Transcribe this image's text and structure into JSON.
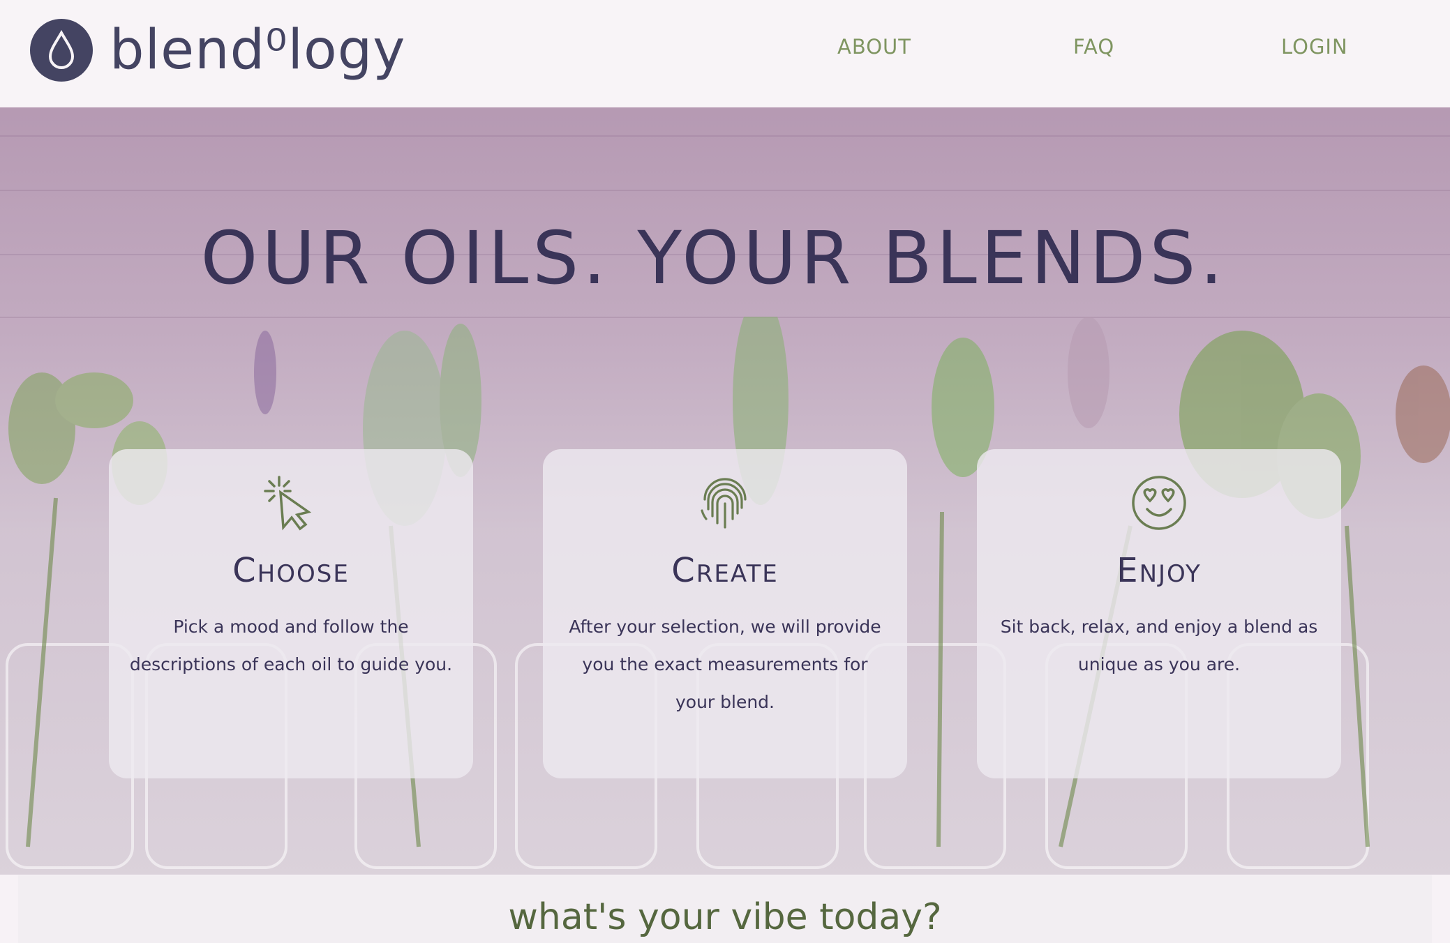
{
  "header": {
    "logo_text": "blend⁰logy",
    "nav": [
      {
        "label": "ABOUT"
      },
      {
        "label": "FAQ"
      },
      {
        "label": "LOGIN"
      }
    ]
  },
  "hero": {
    "headline": "OUR OILS. YOUR BLENDS.",
    "cards": [
      {
        "title": "Choose",
        "description": "Pick a mood and follow the descriptions of each oil to guide you.",
        "icon": "cursor-click-icon"
      },
      {
        "title": "Create",
        "description": "After your selection, we will provide you the exact measurements for your blend.",
        "icon": "fingerprint-icon"
      },
      {
        "title": "Enjoy",
        "description": "Sit back, relax, and enjoy a blend as unique as you are.",
        "icon": "heart-eyes-smiley-icon"
      }
    ]
  },
  "vibe": {
    "prompt": "what's your vibe today?"
  },
  "colors": {
    "brand_navy": "#444462",
    "nav_green": "#7f9561",
    "icon_green": "#6a7d52",
    "vibe_green": "#55673f"
  }
}
